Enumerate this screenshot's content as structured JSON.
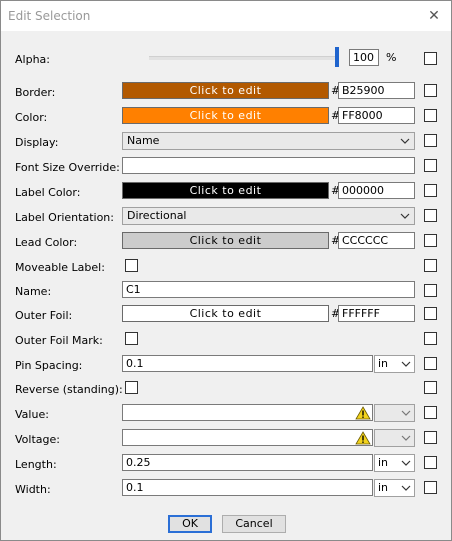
{
  "window": {
    "title": "Edit Selection"
  },
  "alpha": {
    "label": "Alpha:",
    "value": "100",
    "unit": "%",
    "level": 1.0
  },
  "border": {
    "label": "Border:",
    "button": "Click to edit",
    "hash": "#",
    "hex": "B25900",
    "color": "#B25900"
  },
  "color": {
    "label": "Color:",
    "button": "Click to edit",
    "hash": "#",
    "hex": "FF8000",
    "color": "#FF8000"
  },
  "display": {
    "label": "Display:",
    "value": "Name"
  },
  "font_size_override": {
    "label": "Font Size Override:",
    "value": ""
  },
  "label_color": {
    "label": "Label Color:",
    "button": "Click to edit",
    "hash": "#",
    "hex": "000000",
    "color": "#000000"
  },
  "label_orientation": {
    "label": "Label Orientation:",
    "value": "Directional"
  },
  "lead_color": {
    "label": "Lead Color:",
    "button": "Click to edit",
    "hash": "#",
    "hex": "CCCCCC",
    "color": "#CCCCCC"
  },
  "moveable_label": {
    "label": "Moveable Label:"
  },
  "name": {
    "label": "Name:",
    "value": "C1"
  },
  "outer_foil": {
    "label": "Outer Foil:",
    "button": "Click to edit",
    "hash": "#",
    "hex": "FFFFFF",
    "color": "#FFFFFF"
  },
  "outer_foil_mark": {
    "label": "Outer Foil Mark:"
  },
  "pin_spacing": {
    "label": "Pin Spacing:",
    "value": "0.1",
    "unit": "in"
  },
  "reverse": {
    "label": "Reverse (standing):"
  },
  "value": {
    "label": "Value:",
    "value": "",
    "unit": ""
  },
  "voltage": {
    "label": "Voltage:",
    "value": "",
    "unit": ""
  },
  "length": {
    "label": "Length:",
    "value": "0.25",
    "unit": "in"
  },
  "width": {
    "label": "Width:",
    "value": "0.1",
    "unit": "in"
  },
  "buttons": {
    "ok": "OK",
    "cancel": "Cancel"
  },
  "icons": {
    "close": "close-icon",
    "chevron": "chevron-down-icon",
    "warning": "warning-icon"
  },
  "colors": {
    "accent": "#1f64cd",
    "warning": "#f2d21b"
  }
}
